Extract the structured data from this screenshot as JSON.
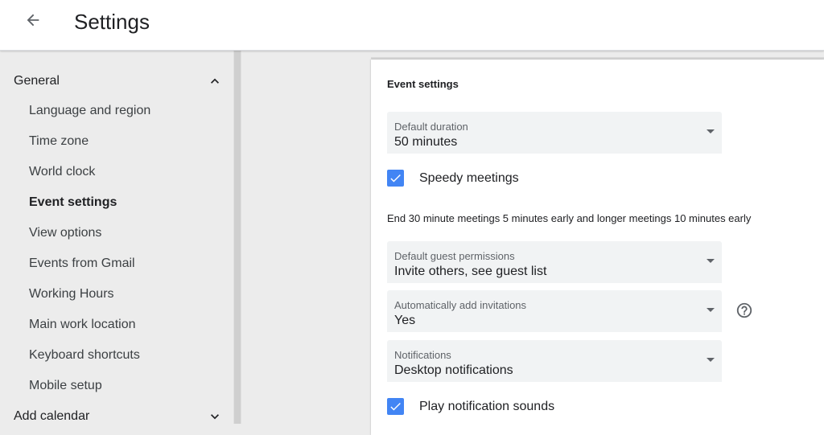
{
  "header": {
    "title": "Settings",
    "back_icon": "arrow-back-icon"
  },
  "sidebar": {
    "general": {
      "label": "General",
      "expanded": true,
      "icon": "chevron-up-icon"
    },
    "items": [
      {
        "label": "Language and region"
      },
      {
        "label": "Time zone"
      },
      {
        "label": "World clock"
      },
      {
        "label": "Event settings",
        "active": true
      },
      {
        "label": "View options"
      },
      {
        "label": "Events from Gmail"
      },
      {
        "label": "Working Hours"
      },
      {
        "label": "Main work location"
      },
      {
        "label": "Keyboard shortcuts"
      },
      {
        "label": "Mobile setup"
      }
    ],
    "add_calendar": {
      "label": "Add calendar",
      "expanded": false,
      "icon": "chevron-down-icon"
    }
  },
  "main": {
    "heading": "Event settings",
    "default_duration": {
      "label": "Default duration",
      "value": "50 minutes"
    },
    "speedy_meetings": {
      "label": "Speedy meetings",
      "checked": true
    },
    "speedy_description": "End 30 minute meetings 5 minutes early and longer meetings 10 minutes early",
    "guest_permissions": {
      "label": "Default guest permissions",
      "value": "Invite others, see guest list"
    },
    "add_invitations": {
      "label": "Automatically add invitations",
      "value": "Yes",
      "help_icon": "help-circle-icon"
    },
    "notifications": {
      "label": "Notifications",
      "value": "Desktop notifications"
    },
    "play_sounds": {
      "label": "Play notification sounds",
      "checked": true
    }
  },
  "colors": {
    "accent": "#4285f4",
    "sidebar_bg": "#ececec",
    "field_bg": "#f1f3f4",
    "text": "#202124"
  }
}
